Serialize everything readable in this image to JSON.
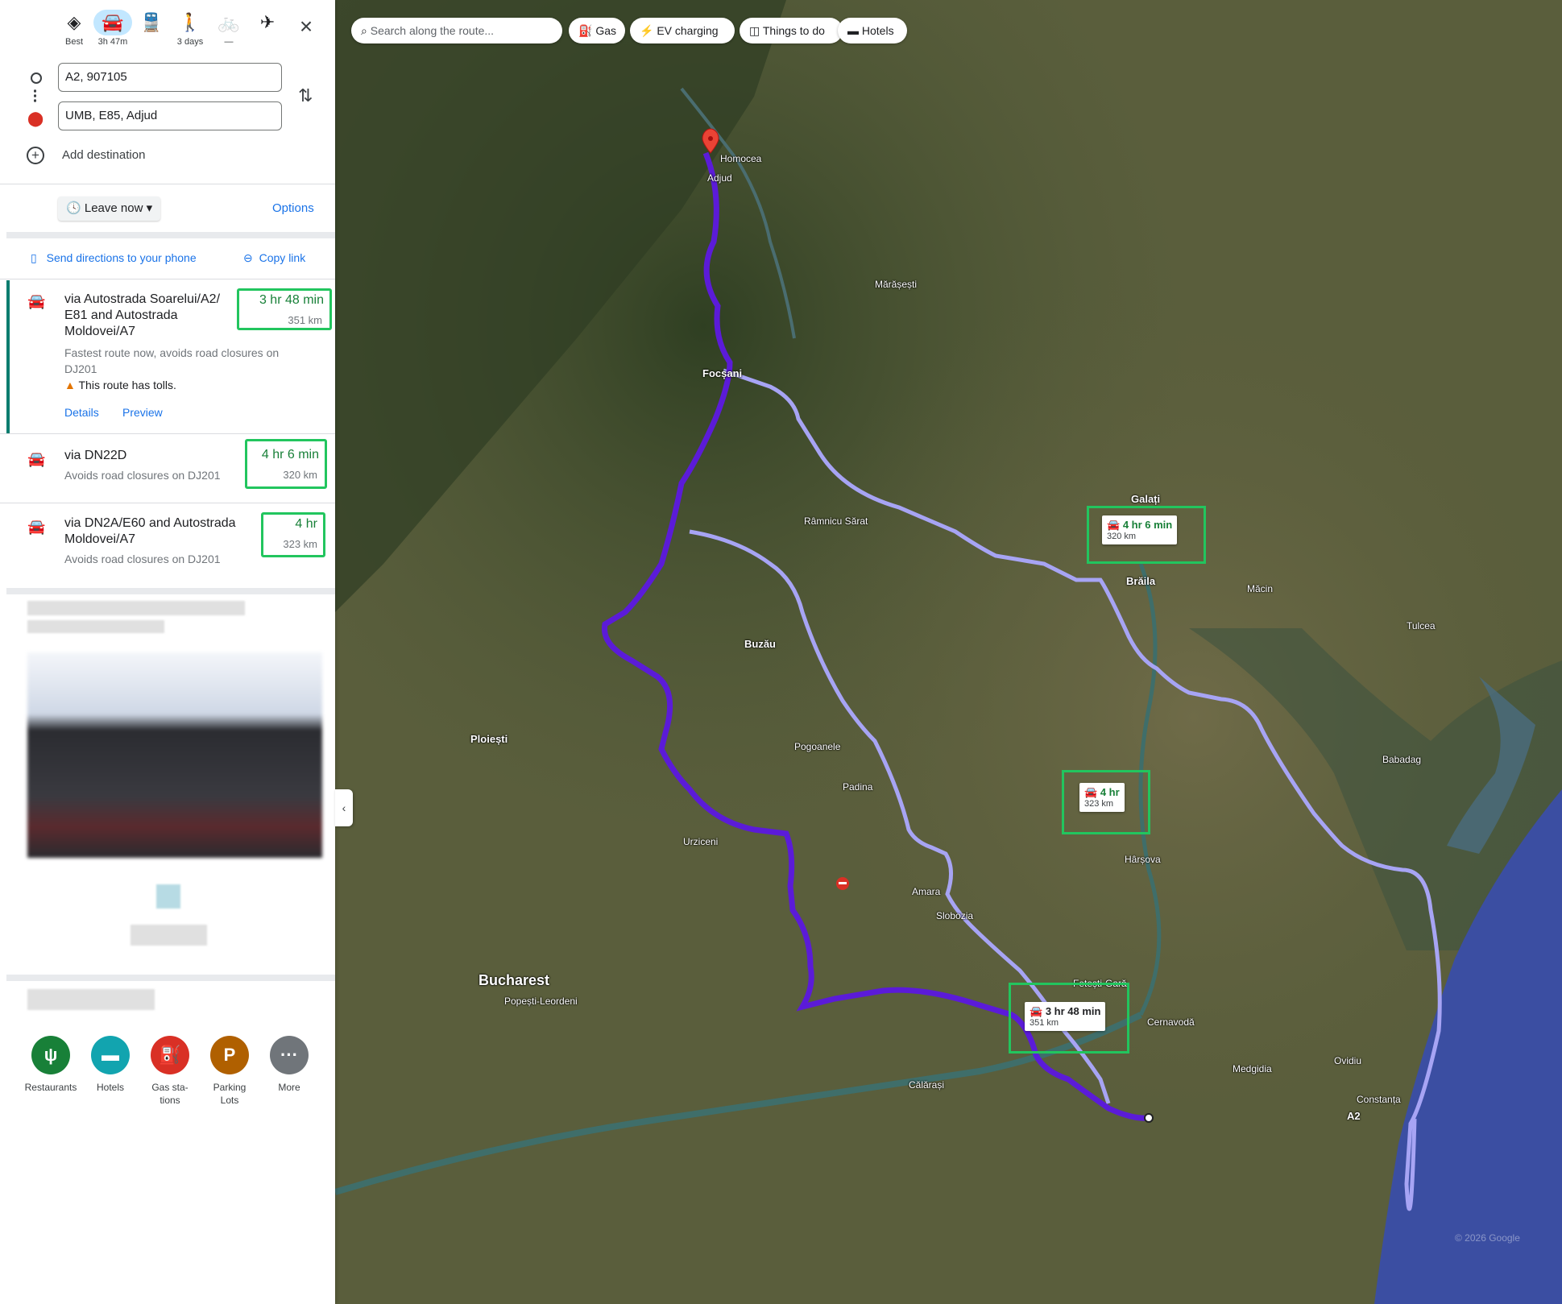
{
  "modes": [
    {
      "label": "Best",
      "icon": "diamond-directions-icon"
    },
    {
      "label": "3h 47m",
      "icon": "car-icon",
      "active": true
    },
    {
      "label": "",
      "icon": "train-icon"
    },
    {
      "label": "3 days",
      "icon": "walk-icon"
    },
    {
      "label": "—",
      "icon": "bike-icon"
    },
    {
      "label": "",
      "icon": "plane-icon"
    }
  ],
  "origin": "A2, 907105",
  "destination": "UMB, E85, Adjud",
  "add_destination": "Add destination",
  "leave_now": "Leave now",
  "options": "Options",
  "send_to_phone": "Send directions to your phone",
  "copy_link": "Copy link",
  "routes": [
    {
      "title": "via Autostrada Soarelui/A2/ E81 and Autostrada Moldovei/A7",
      "duration": "3 hr 48 min",
      "distance": "351 km",
      "note": "Fastest route now, avoids road closures on DJ201",
      "warning": "This route has tolls.",
      "details": "Details",
      "preview": "Preview"
    },
    {
      "title": "via DN22D",
      "duration": "4 hr 6 min",
      "distance": "320 km",
      "note": "Avoids road closures on DJ201"
    },
    {
      "title": "via DN2A/E60 and Autostrada Moldovei/A7",
      "duration": "4 hr",
      "distance": "323 km",
      "note": "Avoids road closures on DJ201"
    }
  ],
  "categories": [
    {
      "label": "Restaurants",
      "icon": "fork-knife-icon",
      "color": "#188038"
    },
    {
      "label": "Hotels",
      "icon": "bed-icon",
      "color": "#12a4af"
    },
    {
      "label": "Gas sta- tions",
      "icon": "gas-pump-icon",
      "color": "#d93025"
    },
    {
      "label": "Parking Lots",
      "icon": "parking-icon",
      "color": "#b06000"
    },
    {
      "label": "More",
      "icon": "more-icon",
      "color": "#70757a"
    }
  ],
  "map": {
    "search_placeholder": "Search along the route...",
    "chips": [
      "Gas",
      "EV charging",
      "Things to do",
      "Hotels"
    ],
    "callouts": [
      {
        "duration": "4 hr 6 min",
        "distance": "320 km"
      },
      {
        "duration": "4 hr",
        "distance": "323 km"
      },
      {
        "duration": "3 hr 48 min",
        "distance": "351 km"
      }
    ],
    "labels": {
      "bucharest": "Bucharest",
      "bucharest_sub": "Popești-Leordeni",
      "braila": "Brăila",
      "galati": "Galați",
      "buzau": "Buzău",
      "focsani": "Focșani",
      "adjud": "Adjud",
      "homocea": "Homocea",
      "constanta": "Constanța",
      "a2": "A2",
      "cernavoda": "Cernavodă",
      "slobozia": "Slobozia",
      "ploiesti": "Ploiești",
      "tulcea": "Tulcea",
      "medgidia": "Medgidia",
      "rmsarat": "Râmnicu Sărat",
      "marasesti": "Mărășești",
      "ovidiu": "Ovidiu",
      "harsova": "Hârșova",
      "macin": "Măcin",
      "babadag": "Babadag",
      "fetesti": "Fetești-Gară",
      "calarasi": "Călărași",
      "urziceni": "Urziceni",
      "padina": "Padina",
      "amara": "Amara",
      "pogoanele": "Pogoanele"
    },
    "watermark": "© 2026 Google"
  }
}
